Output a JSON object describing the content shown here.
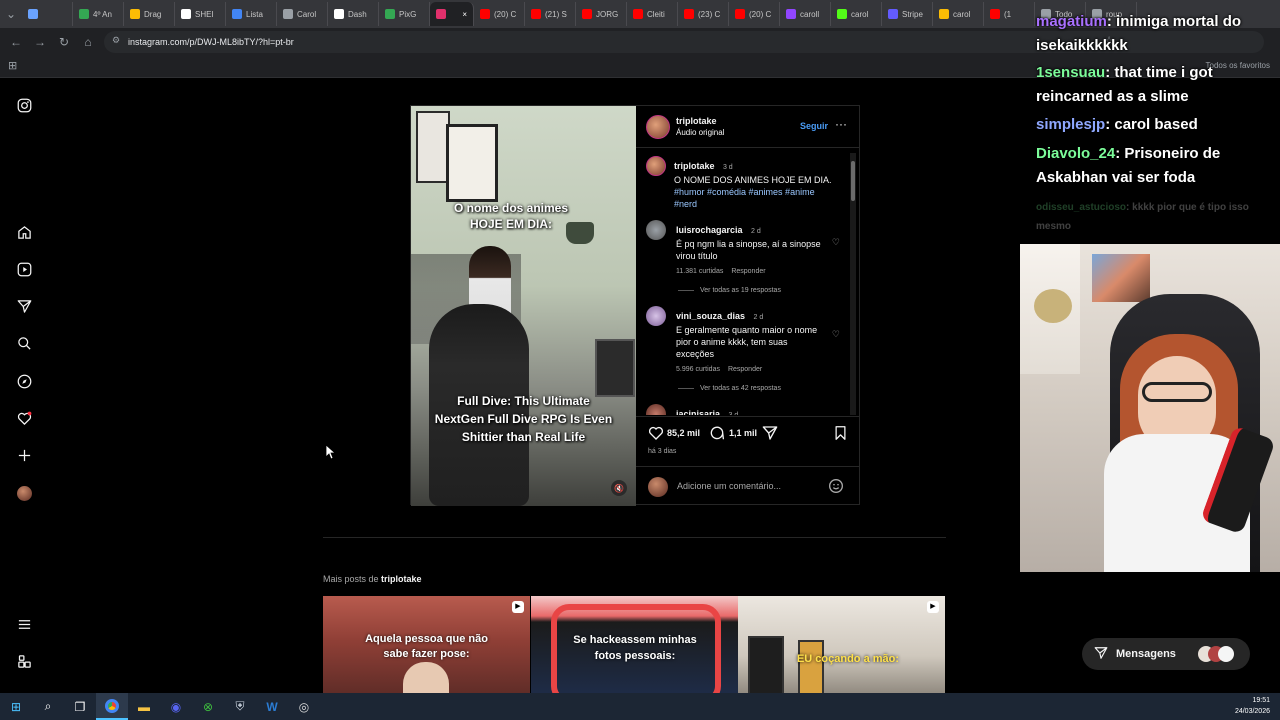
{
  "browser": {
    "tabs": [
      {
        "label": "",
        "color": "#6aa3ff"
      },
      {
        "label": "4º An",
        "color": "#34a853"
      },
      {
        "label": "Drag",
        "color": "#fbbc05"
      },
      {
        "label": "SHEI",
        "color": "#ffffff"
      },
      {
        "label": "Lista",
        "color": "#4285f4"
      },
      {
        "label": "Carol",
        "color": "#9aa0a6"
      },
      {
        "label": "Dash",
        "color": "#ffffff"
      },
      {
        "label": "PixG",
        "color": "#34a853"
      },
      {
        "label": "",
        "color": "#e1306c",
        "active": true
      },
      {
        "label": "(20) C",
        "color": "#ff0000"
      },
      {
        "label": "(21) S",
        "color": "#ff0000"
      },
      {
        "label": "JORG",
        "color": "#ff0000"
      },
      {
        "label": "Cleiti",
        "color": "#ff0000"
      },
      {
        "label": "(23) C",
        "color": "#ff0000"
      },
      {
        "label": "(20) C",
        "color": "#ff0000"
      },
      {
        "label": "caroll",
        "color": "#9146ff"
      },
      {
        "label": "carol",
        "color": "#53fc18"
      },
      {
        "label": "Stripe",
        "color": "#635bff"
      },
      {
        "label": "carol",
        "color": "#fbbc05"
      },
      {
        "label": "(1",
        "color": "#ff0000"
      },
      {
        "label": "Todo",
        "color": "#9aa0a6"
      },
      {
        "label": "roup",
        "color": "#9aa0a6"
      }
    ],
    "url": "instagram.com/p/DWJ-ML8ibTY/?hl=pt-br",
    "all_bookmarks": "Todos os favoritos"
  },
  "post": {
    "username": "triplotake",
    "audio": "Áudio original",
    "follow": "Seguir",
    "video_top_text": "O nome dos animes HOJE EM DIA:",
    "video_bottom_text": "Full Dive: This Ultimate NextGen Full Dive RPG Is Even Shittier than Real Life",
    "caption": {
      "username": "triplotake",
      "time": "3 d",
      "text": "O NOME DOS ANIMES HOJE EM DIA.",
      "hashtags": "#humor #comédia #animes #anime #nerd"
    },
    "comments": [
      {
        "username": "luisrochagarcia",
        "time": "2 d",
        "text": "É pq ngm lia a sinopse, aí a sinopse virou título",
        "likes": "11.381 curtidas",
        "reply": "Responder",
        "view_replies": "Ver todas as 19 respostas"
      },
      {
        "username": "vini_souza_dias",
        "time": "2 d",
        "text": "E geralmente quanto maior o nome pior o anime kkkk, tem suas exceções",
        "likes": "5.996 curtidas",
        "reply": "Responder",
        "view_replies": "Ver todas as 42 respostas"
      },
      {
        "username": "jacinisaria",
        "time": "3 d"
      }
    ],
    "like_count": "85,2 mil",
    "comment_count": "1,1 mil",
    "posted": "há 3 dias",
    "add_comment": "Adicione um comentário..."
  },
  "more_posts": {
    "label_prefix": "Mais posts de",
    "username": "triplotake",
    "thumbs": [
      {
        "caption": "Aquela pessoa que não sabe fazer pose:"
      },
      {
        "caption": "Se hackeassem minhas fotos pessoais:"
      },
      {
        "caption": "EU coçando a mão:"
      }
    ]
  },
  "stream_chat": [
    {
      "user": "magatium",
      "msg": ": inimiga mortal do isekaikkkkkk",
      "color": "#a970ff"
    },
    {
      "user": "1sensuau",
      "msg": ": that time i got reincarned as a slime",
      "color": "#7cfc9a"
    },
    {
      "user": "simplesjp",
      "msg": ": carol based",
      "color": "#8fa8ff"
    },
    {
      "user": "Diavolo_24",
      "msg": ": Prisoneiro de Askabhan vai ser foda",
      "color": "#7cfc9a"
    },
    {
      "user": "odisseu_astucioso",
      "msg": ": kkkk pior que é tipo isso mesmo",
      "color": "#7cfc9a"
    }
  ],
  "messages_label": "Mensagens",
  "taskbar": {
    "time": "19:51",
    "date": "24/03/2026"
  }
}
